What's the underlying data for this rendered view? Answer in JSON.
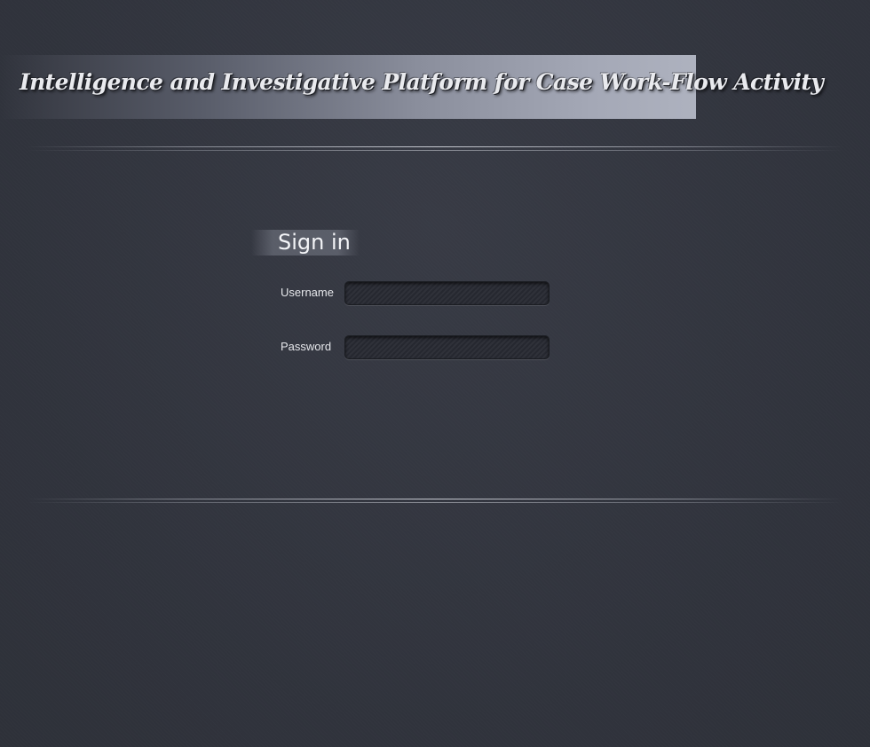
{
  "header": {
    "title": "Intelligence and Investigative Platform for Case Work-Flow Activity"
  },
  "login": {
    "heading": "Sign in",
    "username_label": "Username",
    "password_label": "Password",
    "username_value": "",
    "password_value": ""
  },
  "colors": {
    "background": "#33363f",
    "text": "#e6e7eb"
  }
}
